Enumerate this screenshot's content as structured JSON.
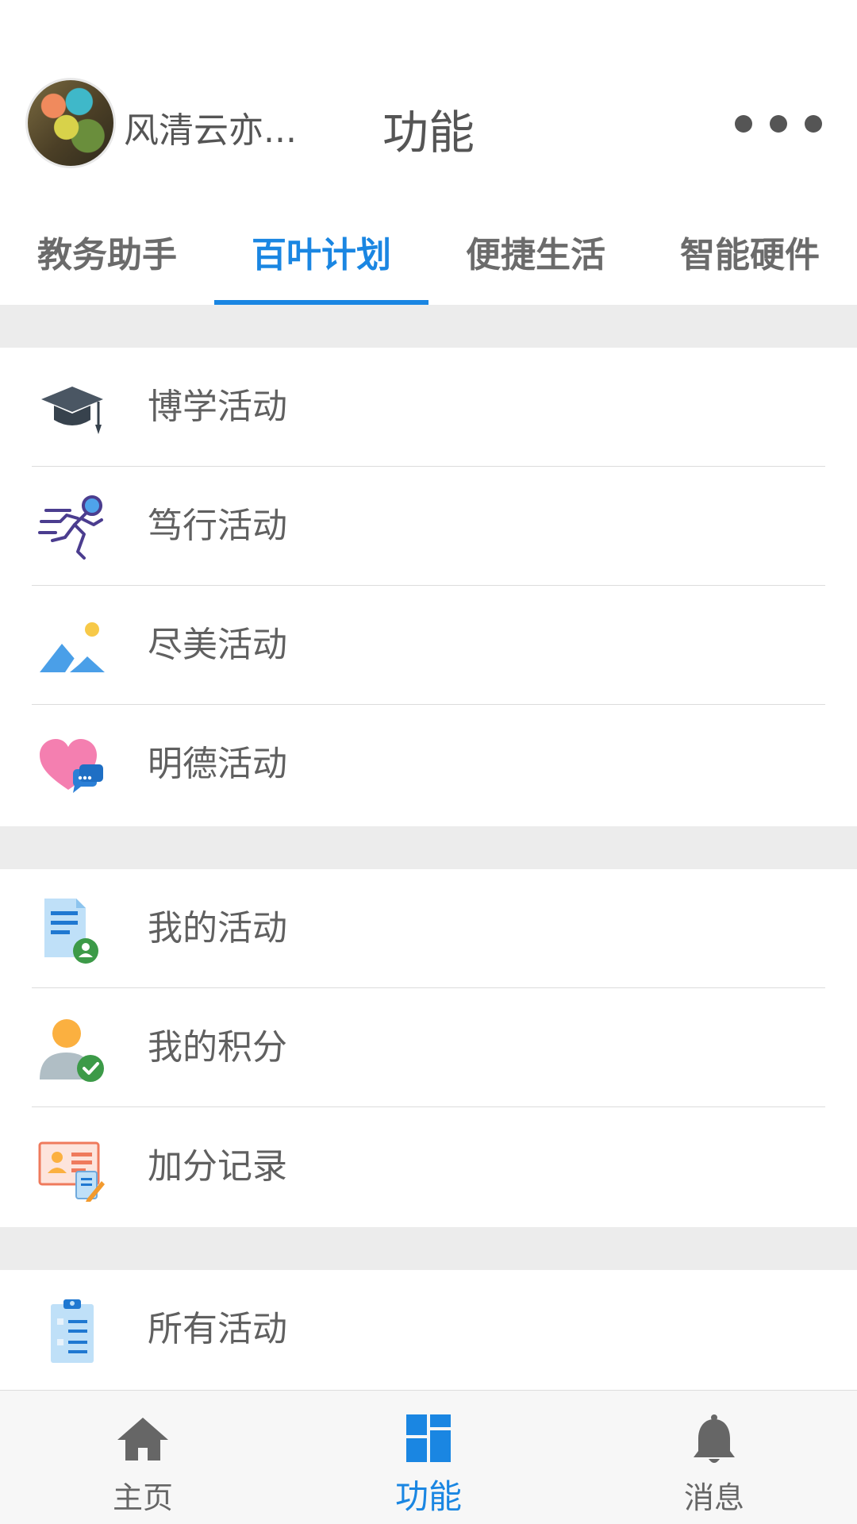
{
  "header": {
    "username": "风清云亦...",
    "title": "功能"
  },
  "tabs": [
    {
      "label": "教务助手",
      "active": false
    },
    {
      "label": "百叶计划",
      "active": true
    },
    {
      "label": "便捷生活",
      "active": false
    },
    {
      "label": "智能硬件",
      "active": false
    }
  ],
  "sections": [
    {
      "items": [
        {
          "label": "博学活动",
          "icon": "graduation-cap-icon"
        },
        {
          "label": "笃行活动",
          "icon": "runner-icon"
        },
        {
          "label": "尽美活动",
          "icon": "landscape-icon"
        },
        {
          "label": "明德活动",
          "icon": "heart-chat-icon"
        }
      ]
    },
    {
      "items": [
        {
          "label": "我的活动",
          "icon": "document-user-icon"
        },
        {
          "label": "我的积分",
          "icon": "user-check-icon"
        },
        {
          "label": "加分记录",
          "icon": "id-card-edit-icon"
        }
      ]
    },
    {
      "items": [
        {
          "label": "所有活动",
          "icon": "clipboard-list-icon"
        }
      ]
    }
  ],
  "bottom_nav": [
    {
      "label": "主页",
      "icon": "home-icon",
      "active": false
    },
    {
      "label": "功能",
      "icon": "grid-icon",
      "active": true
    },
    {
      "label": "消息",
      "icon": "bell-icon",
      "active": false
    }
  ],
  "colors": {
    "accent": "#1a86e2",
    "text": "#555555",
    "section_gap": "#ececec"
  }
}
